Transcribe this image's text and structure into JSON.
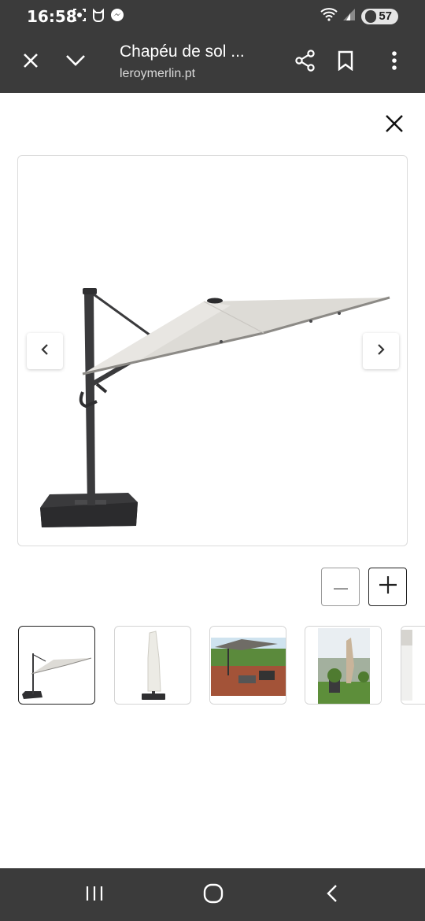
{
  "status_bar": {
    "time": "16:58",
    "battery": "57",
    "icons_left": [
      "screen-record-icon",
      "cat-face-icon",
      "messenger-icon"
    ],
    "icons_right": [
      "wifi-icon",
      "signal-icon"
    ]
  },
  "toolbar": {
    "title": "Chapéu de sol ...",
    "url": "leroymerlin.pt",
    "icons": [
      "close-icon",
      "chevron-down-icon",
      "share-icon",
      "bookmark-icon",
      "more-vert-icon"
    ]
  },
  "viewer": {
    "close_icon": "close-icon",
    "main_image": "cantilever-umbrella-photo",
    "prev_icon": "chevron-left-icon",
    "next_icon": "chevron-right-icon",
    "zoom_out_icon": "minus-icon",
    "zoom_in_icon": "plus-icon",
    "thumbnails": [
      {
        "name": "thumbnail-umbrella-open",
        "selected": true
      },
      {
        "name": "thumbnail-umbrella-covered",
        "selected": false
      },
      {
        "name": "thumbnail-umbrella-patio",
        "selected": false
      },
      {
        "name": "thumbnail-umbrella-garden",
        "selected": false
      },
      {
        "name": "thumbnail-partial",
        "selected": false
      }
    ]
  },
  "navigation_bar": {
    "icons": [
      "recent-apps-icon",
      "home-icon",
      "back-icon"
    ]
  },
  "colors": {
    "chrome": "#3b3b3b",
    "umbrella_canopy": "#dddbd6",
    "pole": "#3a3a3c"
  }
}
